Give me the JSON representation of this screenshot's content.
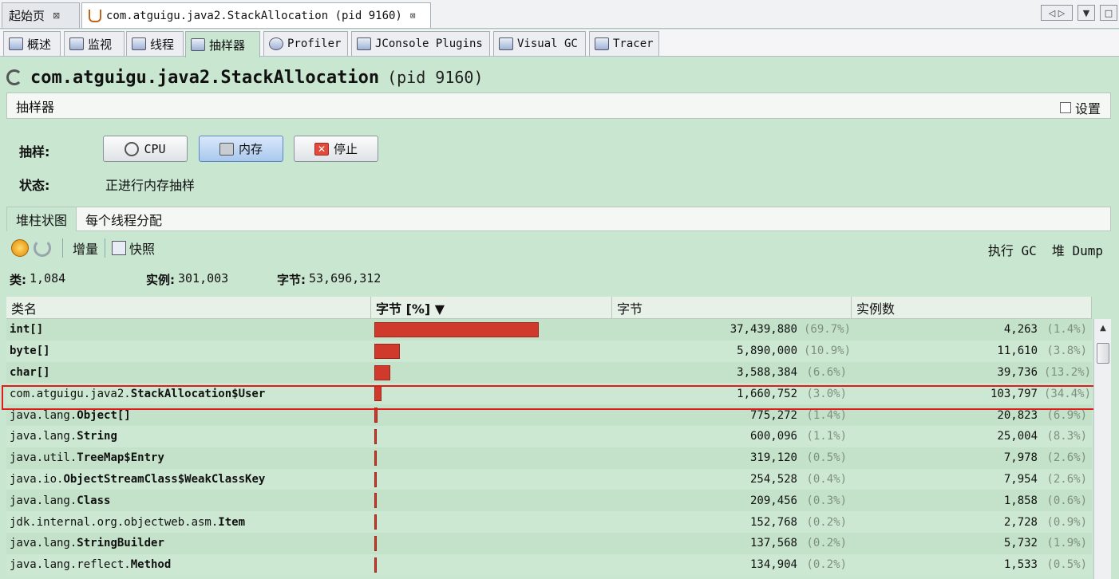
{
  "doc_tabs": [
    {
      "label": "起始页",
      "close": "⊠"
    },
    {
      "label": "com.atguigu.java2.StackAllocation (pid 9160)",
      "close": "⊠"
    }
  ],
  "view_tabs": [
    "概述",
    "监视",
    "线程",
    "抽样器",
    "Profiler",
    "JConsole Plugins",
    "Visual GC",
    "Tracer"
  ],
  "header": {
    "title": "com.atguigu.java2.StackAllocation",
    "pid": "(pid 9160)"
  },
  "sampler": {
    "panel_label": "抽样器",
    "settings_label": "设置",
    "sample_label": "抽样:",
    "cpu_button": "CPU",
    "memory_button": "内存",
    "stop_button": "停止",
    "status_label": "状态:",
    "status_value": "正进行内存抽样"
  },
  "sub_tabs": [
    "堆柱状图",
    "每个线程分配"
  ],
  "toolbar": {
    "delta": "增量",
    "snapshot": "快照",
    "gc": "执行 GC",
    "heap_dump": "堆 Dump"
  },
  "stats": {
    "classes_label": "类:",
    "classes_value": "1,084",
    "instances_label": "实例:",
    "instances_value": "301,003",
    "bytes_label": "字节:",
    "bytes_value": "53,696,312"
  },
  "table": {
    "columns": [
      "类名",
      "字节 [%] ▼",
      "字节",
      "实例数"
    ],
    "rows": [
      {
        "prefix": "",
        "name": "int[]",
        "pct": 69.7,
        "bytes": "37,439,880",
        "bytes_pct": "(69.7%)",
        "inst": "4,263",
        "inst_pct": "(1.4%)"
      },
      {
        "prefix": "",
        "name": "byte[]",
        "pct": 10.9,
        "bytes": "5,890,000",
        "bytes_pct": "(10.9%)",
        "inst": "11,610",
        "inst_pct": "(3.8%)"
      },
      {
        "prefix": "",
        "name": "char[]",
        "pct": 6.6,
        "bytes": "3,588,384",
        "bytes_pct": "(6.6%)",
        "inst": "39,736",
        "inst_pct": "(13.2%)"
      },
      {
        "prefix": "com.atguigu.java2.",
        "name": "StackAllocation$User",
        "pct": 3.0,
        "bytes": "1,660,752",
        "bytes_pct": "(3.0%)",
        "inst": "103,797",
        "inst_pct": "(34.4%)"
      },
      {
        "prefix": "java.lang.",
        "name": "Object[]",
        "pct": 1.4,
        "bytes": "775,272",
        "bytes_pct": "(1.4%)",
        "inst": "20,823",
        "inst_pct": "(6.9%)"
      },
      {
        "prefix": "java.lang.",
        "name": "String",
        "pct": 1.1,
        "bytes": "600,096",
        "bytes_pct": "(1.1%)",
        "inst": "25,004",
        "inst_pct": "(8.3%)"
      },
      {
        "prefix": "java.util.",
        "name": "TreeMap$Entry",
        "pct": 0.5,
        "bytes": "319,120",
        "bytes_pct": "(0.5%)",
        "inst": "7,978",
        "inst_pct": "(2.6%)"
      },
      {
        "prefix": "java.io.",
        "name": "ObjectStreamClass$WeakClassKey",
        "pct": 0.4,
        "bytes": "254,528",
        "bytes_pct": "(0.4%)",
        "inst": "7,954",
        "inst_pct": "(2.6%)"
      },
      {
        "prefix": "java.lang.",
        "name": "Class",
        "pct": 0.3,
        "bytes": "209,456",
        "bytes_pct": "(0.3%)",
        "inst": "1,858",
        "inst_pct": "(0.6%)"
      },
      {
        "prefix": "jdk.internal.org.objectweb.asm.",
        "name": "Item",
        "pct": 0.2,
        "bytes": "152,768",
        "bytes_pct": "(0.2%)",
        "inst": "2,728",
        "inst_pct": "(0.9%)"
      },
      {
        "prefix": "java.lang.",
        "name": "StringBuilder",
        "pct": 0.2,
        "bytes": "137,568",
        "bytes_pct": "(0.2%)",
        "inst": "5,732",
        "inst_pct": "(1.9%)"
      },
      {
        "prefix": "java.lang.reflect.",
        "name": "Method",
        "pct": 0.2,
        "bytes": "134,904",
        "bytes_pct": "(0.2%)",
        "inst": "1,533",
        "inst_pct": "(0.5%)"
      }
    ]
  },
  "colors": {
    "panel_bg": "#c9e6d0",
    "bar": "#d03a2c",
    "highlight": "#e11a1a"
  }
}
